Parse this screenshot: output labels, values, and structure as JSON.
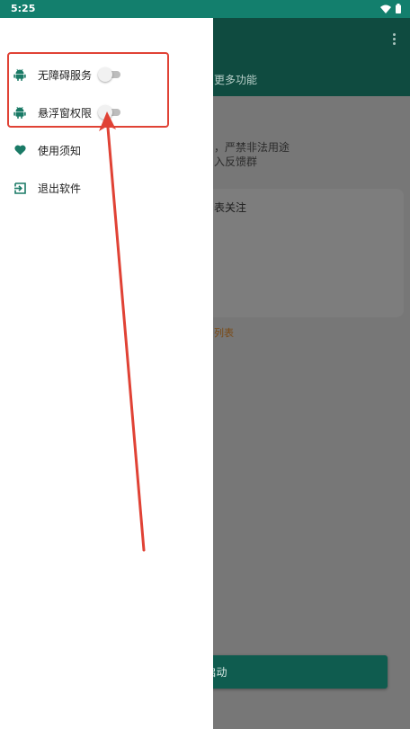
{
  "status_bar": {
    "time": "5:25",
    "icons": [
      "wifi-icon",
      "battery-icon"
    ]
  },
  "background_app": {
    "more_features_label": "更多功能",
    "notice_lines": [
      "，严禁非法用途",
      "入反馈群"
    ],
    "follow_card_title": "表关注",
    "list_link": "列表",
    "start_button_label": "开始启动"
  },
  "drawer": {
    "items": [
      {
        "label": "无障碍服务",
        "icon": "android-icon",
        "has_toggle": true,
        "toggle_on": false
      },
      {
        "label": "悬浮窗权限",
        "icon": "android-icon",
        "has_toggle": true,
        "toggle_on": false
      },
      {
        "label": "使用须知",
        "icon": "heart-icon",
        "has_toggle": false
      },
      {
        "label": "退出软件",
        "icon": "exit-icon",
        "has_toggle": false
      }
    ]
  },
  "colors": {
    "status_bar": "#137f6d",
    "drawer_icon": "#1a7a66",
    "annotation": "#e04235",
    "toolbar_dimmed": "#0f4b40",
    "start_button_dimmed": "#0f5c4f"
  }
}
